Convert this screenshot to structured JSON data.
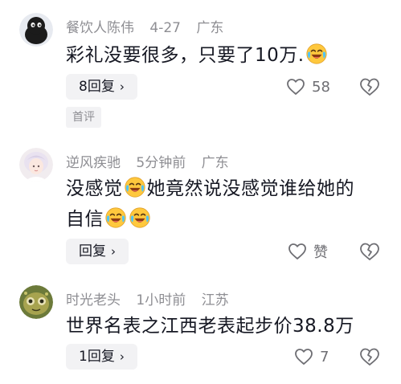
{
  "comments": [
    {
      "author": "餐饮人陈伟",
      "time": "4-27",
      "location": "广东",
      "text_a": "彩礼没要很多，只要了10万.",
      "text_b": "",
      "text_c": "",
      "reply_label": "8回复",
      "like_count": "58",
      "badge": "首评"
    },
    {
      "author": "逆风疾驰",
      "time": "5分钟前",
      "location": "广东",
      "text_a": "没感觉",
      "text_b": "她竟然说没感觉谁给她的",
      "text_c": "自信",
      "reply_label": "回复",
      "like_count": "赞"
    },
    {
      "author": "时光老头",
      "time": "1小时前",
      "location": "江苏",
      "text_a": "世界名表之江西老表起步价38.8万",
      "reply_label": "1回复",
      "like_count": "7"
    }
  ],
  "icons": {
    "reply_chevron": "chevron-right-icon",
    "like": "heart-outline-icon",
    "dislike": "broken-heart-icon",
    "emoji": "laughing-crying-emoji-icon"
  },
  "colors": {
    "primary_text": "#161823",
    "secondary_text": "#8e8e93",
    "button_bg": "#f2f2f4",
    "emoji_yellow": "#ffc83d"
  }
}
